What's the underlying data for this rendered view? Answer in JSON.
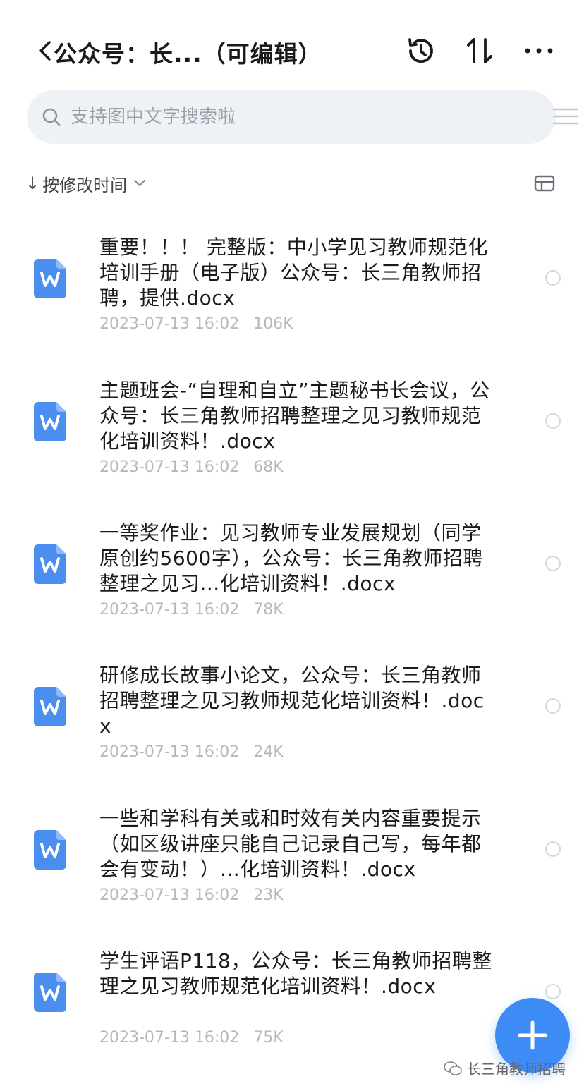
{
  "header": {
    "title": "公众号：长...（可编辑）",
    "icons": [
      "back-icon",
      "history-icon",
      "sort-toggle-icon",
      "more-icon"
    ]
  },
  "search": {
    "placeholder": "支持图中文字搜索啦"
  },
  "sort": {
    "arrow": "↓",
    "label": "按修改时间"
  },
  "files": [
    {
      "name": "重要！！！ 完整版：中小学见习教师规范化培训手册（电子版）公众号：长三角教师招聘，提供.docx",
      "date": "2023-07-13 16:02",
      "size": "106K"
    },
    {
      "name": "主题班会-“自理和自立”主题秘书长会议，公众号：长三角教师招聘整理之见习教师规范化培训资料！.docx",
      "date": "2023-07-13 16:02",
      "size": "68K"
    },
    {
      "name": "一等奖作业：见习教师专业发展规划（同学原创约5600字），公众号：长三角教师招聘整理之见习...化培训资料！.docx",
      "date": "2023-07-13 16:02",
      "size": "78K"
    },
    {
      "name": "研修成长故事小论文，公众号：长三角教师招聘整理之见习教师规范化培训资料！.docx",
      "date": "2023-07-13 16:02",
      "size": "24K"
    },
    {
      "name": "一些和学科有关或和时效有关内容重要提示（如区级讲座只能自己记录自己写，每年都会有变动！）...化培训资料！.docx",
      "date": "2023-07-13 16:02",
      "size": "23K"
    },
    {
      "name": "学生评语P118，公众号：长三角教师招聘整理之见习教师规范化培训资料！.docx",
      "date": "2023-07-13 16:02",
      "size": "75K"
    }
  ],
  "watermark": {
    "text": "长三角教师招聘"
  },
  "colors": {
    "accent": "#3d8bf5",
    "word_icon": "#4a8ef0",
    "meta_text": "#b5b8bd",
    "search_bg": "#eef1f6"
  }
}
